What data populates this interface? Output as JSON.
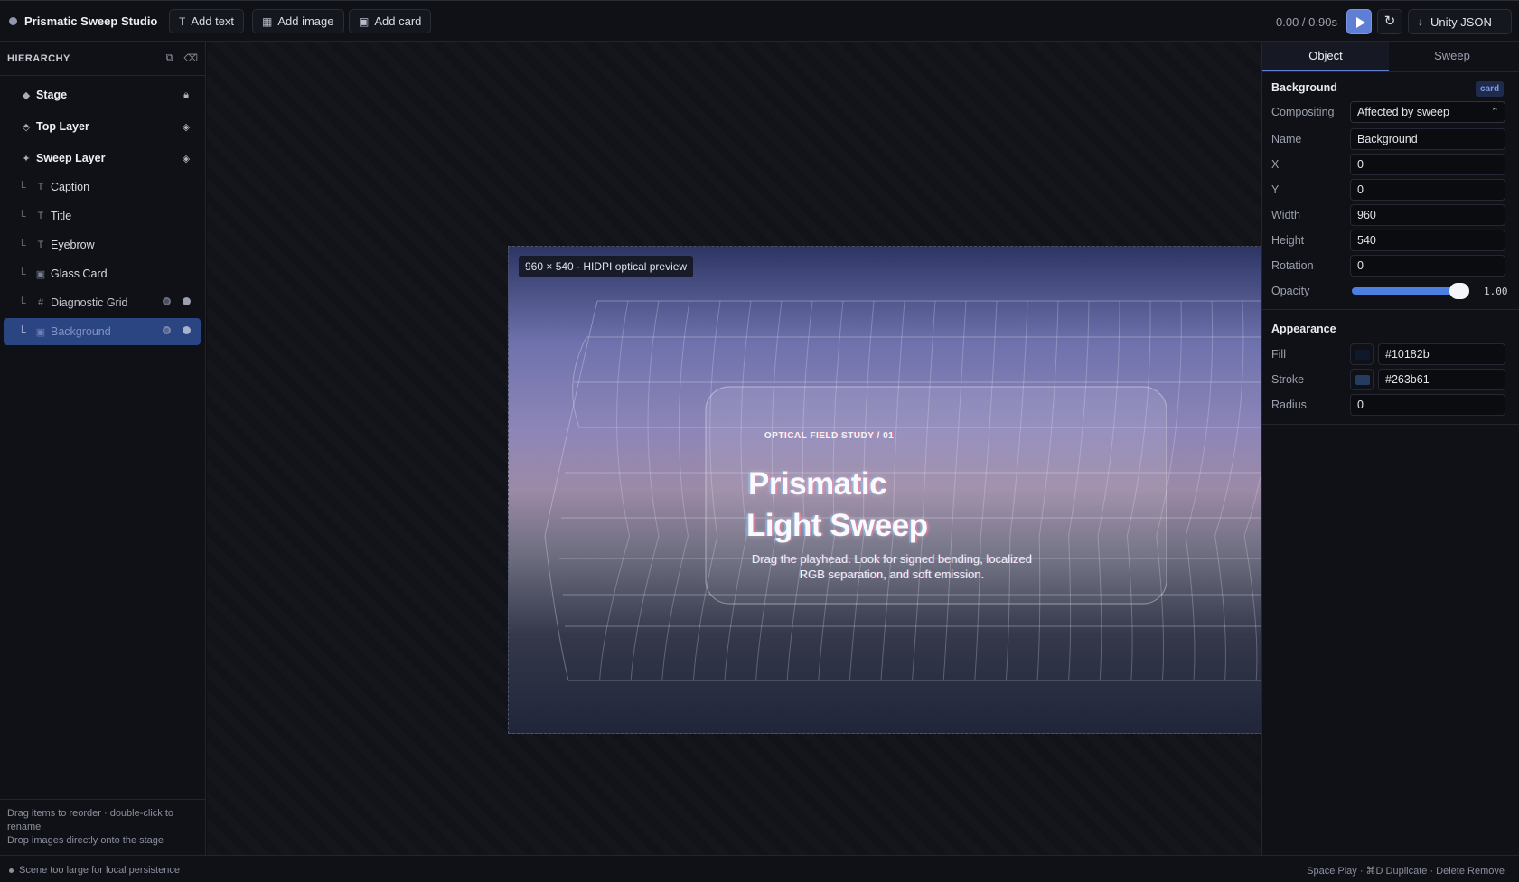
{
  "app": {
    "title": "Prismatic Sweep Studio"
  },
  "toolbar": {
    "add_text": "Add text",
    "add_image": "Add image",
    "add_card": "Add card",
    "time": "0.00 / 0.90s",
    "export": "Unity JSON"
  },
  "hierarchy": {
    "title": "HIERARCHY",
    "items": [
      {
        "label": "Stage",
        "type_icon": "diamond-icon",
        "right_icon": "lock-icon"
      },
      {
        "label": "Top Layer",
        "type_icon": "layer-icon",
        "right_icon": "diamond-icon"
      },
      {
        "label": "Sweep Layer",
        "type_icon": "sparkle-icon",
        "right_icon": "diamond-icon"
      },
      {
        "label": "Caption",
        "type_icon": "text-icon"
      },
      {
        "label": "Title",
        "type_icon": "text-icon"
      },
      {
        "label": "Eyebrow",
        "type_icon": "text-icon"
      },
      {
        "label": "Glass Card",
        "type_icon": "card-icon"
      },
      {
        "label": "Diagnostic Grid",
        "type_icon": "grid-icon"
      },
      {
        "label": "Background",
        "type_icon": "card-icon",
        "selected": true
      }
    ],
    "footer_line1": "Drag items to reorder · double-click to rename",
    "footer_line2": "Drop images directly onto the stage"
  },
  "status": {
    "message": "Scene too large for local persistence",
    "shortcuts": "Space Play · ⌘D Duplicate · Delete Remove"
  },
  "stage": {
    "tag": "960 × 540 · HIDPI optical preview",
    "eyebrow": "OPTICAL FIELD STUDY / 01",
    "title_line1": "Prismatic",
    "title_line2": "Light Sweep",
    "caption": "Drag the playhead. Look for signed bending, localized RGB separation, and soft emission."
  },
  "inspector": {
    "tabs": [
      "Object",
      "Sweep"
    ],
    "active_tab": "Object",
    "object_name": "Background",
    "object_badge": "card",
    "compositing_label": "Compositing",
    "compositing_value": "Affected by sweep",
    "name_label": "Name",
    "name_value": "Background",
    "x_label": "X",
    "x_value": "0",
    "y_label": "Y",
    "y_value": "0",
    "width_label": "Width",
    "width_value": "960",
    "height_label": "Height",
    "height_value": "540",
    "rotation_label": "Rotation",
    "rotation_value": "0",
    "opacity_label": "Opacity",
    "opacity_value": "1.00",
    "opacity_fraction": 1.0,
    "appearance_title": "Appearance",
    "fill_label": "Fill",
    "fill_value": "#10182b",
    "stroke_label": "Stroke",
    "stroke_value": "#263b61",
    "radius_label": "Radius",
    "radius_value": "0"
  },
  "colors": {
    "accent": "#5f7fd6",
    "selection": "#2b4482",
    "fill": "#10182b",
    "stroke": "#263b61"
  }
}
